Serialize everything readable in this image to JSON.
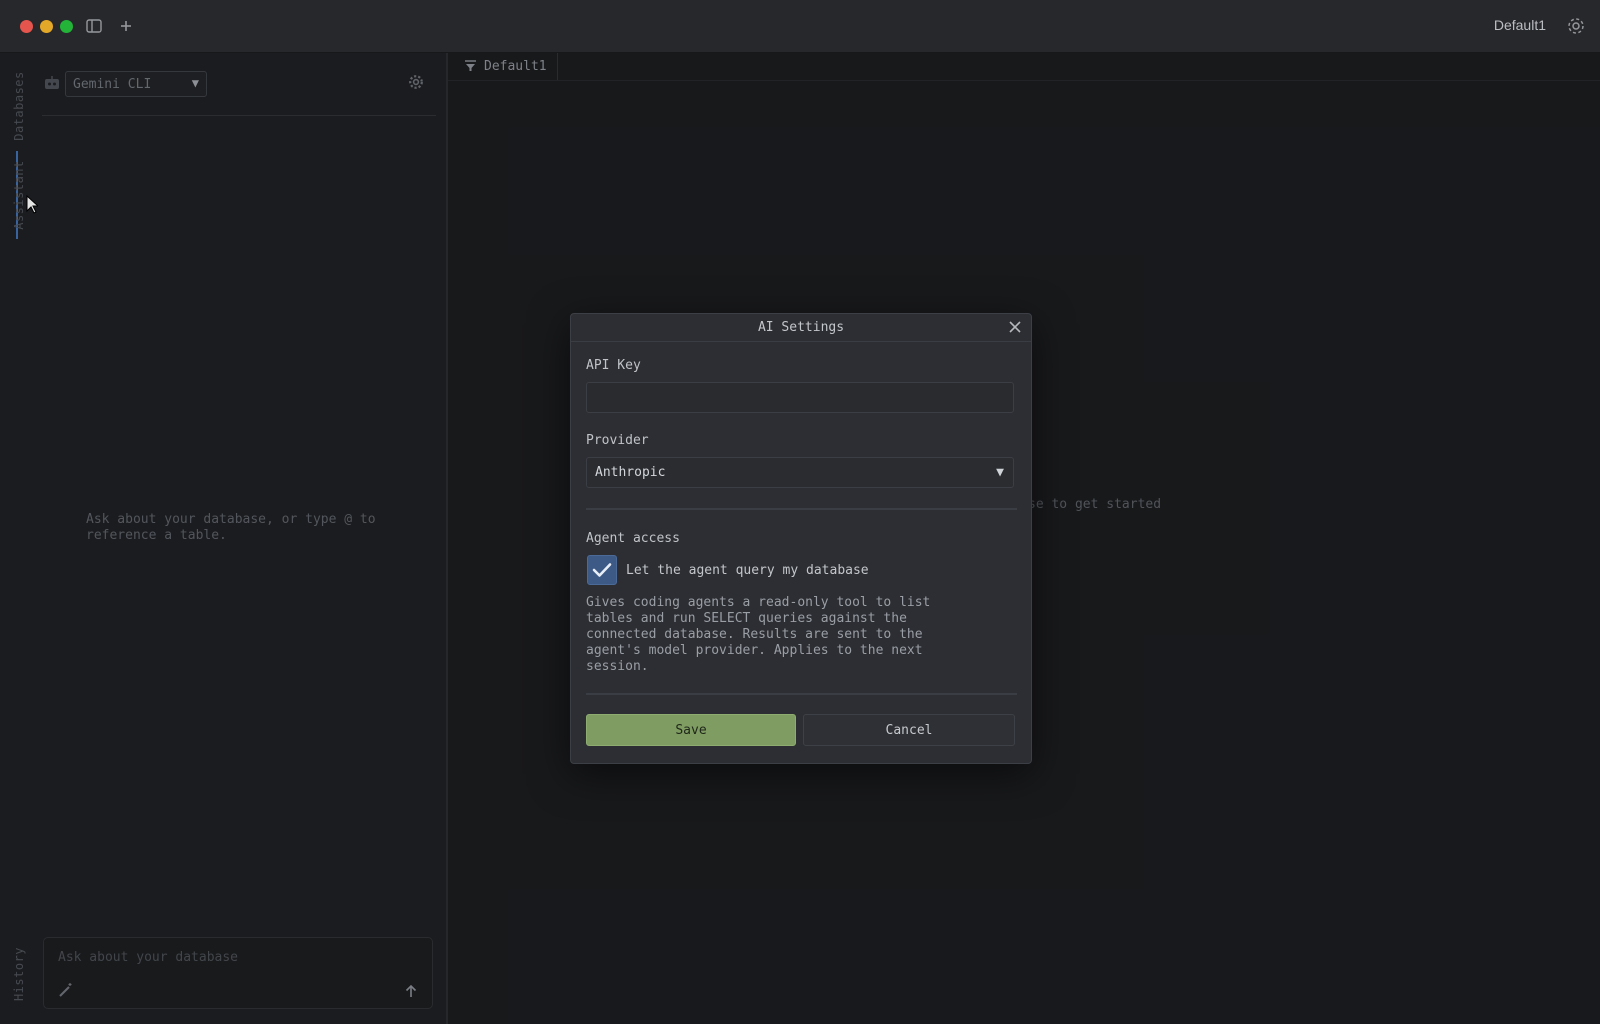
{
  "titlebar": {
    "workspace_label": "Default1",
    "traffic_lights": [
      "#ff5f57",
      "#febc2e",
      "#28c840"
    ],
    "icons": [
      "sidebar-toggle-icon",
      "plus-icon",
      "gear-icon"
    ]
  },
  "side_rail": {
    "tabs": [
      "Databases",
      "Assistant",
      "History"
    ],
    "active_tab": "Assistant",
    "accent_color": "#3f6fb0"
  },
  "assistant_panel": {
    "agent_selected": "Gemini CLI",
    "empty_hint": "Ask about your database, or type @ to\nreference a table.",
    "chat_placeholder": "Ask about your database",
    "icons": [
      "robot-icon",
      "gear-icon",
      "magic-wand-icon",
      "send-arrow-icon"
    ]
  },
  "main": {
    "tab_label": "Default1",
    "partial_hint": "se to get started"
  },
  "modal": {
    "title": "AI Settings",
    "api_key_label": "API Key",
    "api_key_value": "",
    "provider_label": "Provider",
    "provider_value": "Anthropic",
    "agent_access_label": "Agent access",
    "agent_access_checked": true,
    "checkbox_label": "Let the agent query my database",
    "description": "Gives coding agents a read-only tool to list tables and run SELECT queries against the connected database. Results are sent to the agent's model provider. Applies to the next session.",
    "save_label": "Save",
    "cancel_label": "Cancel",
    "save_color": "#7f9c62",
    "checkbox_color": "#3d5a86"
  }
}
